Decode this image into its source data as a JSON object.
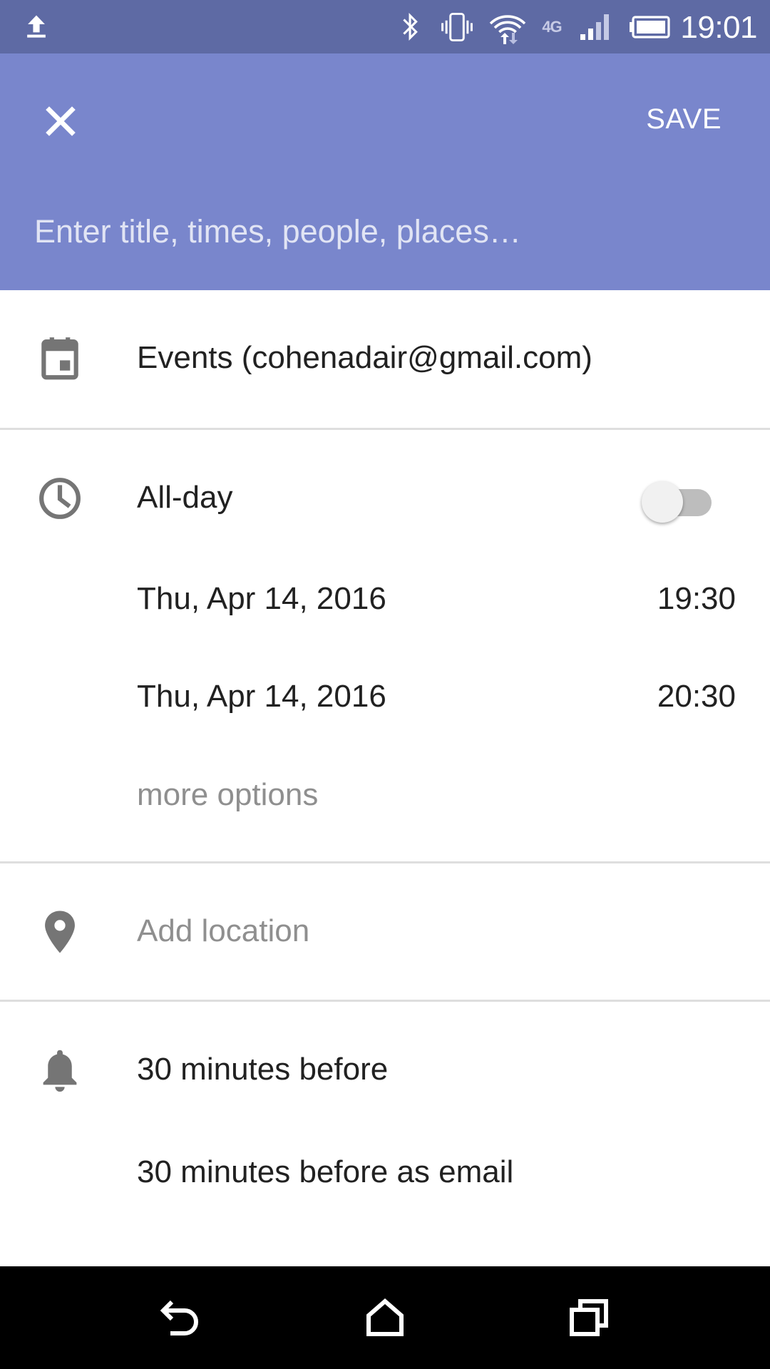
{
  "status_bar": {
    "time": "19:01",
    "network_label": "4G",
    "icons": [
      "upload-icon",
      "bluetooth-icon",
      "vibrate-icon",
      "wifi-icon",
      "signal-icon",
      "battery-icon"
    ]
  },
  "header": {
    "close_icon": "close-icon",
    "save_label": "SAVE",
    "title_placeholder": "Enter title, times, people, places…",
    "background_color": "#7986cc",
    "status_bar_color": "#5e6aa4"
  },
  "calendar": {
    "icon": "calendar-icon",
    "label": "Events (cohenadair@gmail.com)"
  },
  "time_section": {
    "icon": "clock-icon",
    "all_day_label": "All-day",
    "all_day_on": false,
    "start": {
      "date": "Thu, Apr 14, 2016",
      "time": "19:30"
    },
    "end": {
      "date": "Thu, Apr 14, 2016",
      "time": "20:30"
    },
    "more_options_label": "more options"
  },
  "location": {
    "icon": "location-pin-icon",
    "placeholder": "Add location"
  },
  "notifications": {
    "icon": "bell-icon",
    "items": [
      "30 minutes before",
      "30 minutes before as email"
    ]
  },
  "nav_bar": {
    "icons": [
      "back-icon",
      "home-icon",
      "recents-icon"
    ]
  }
}
